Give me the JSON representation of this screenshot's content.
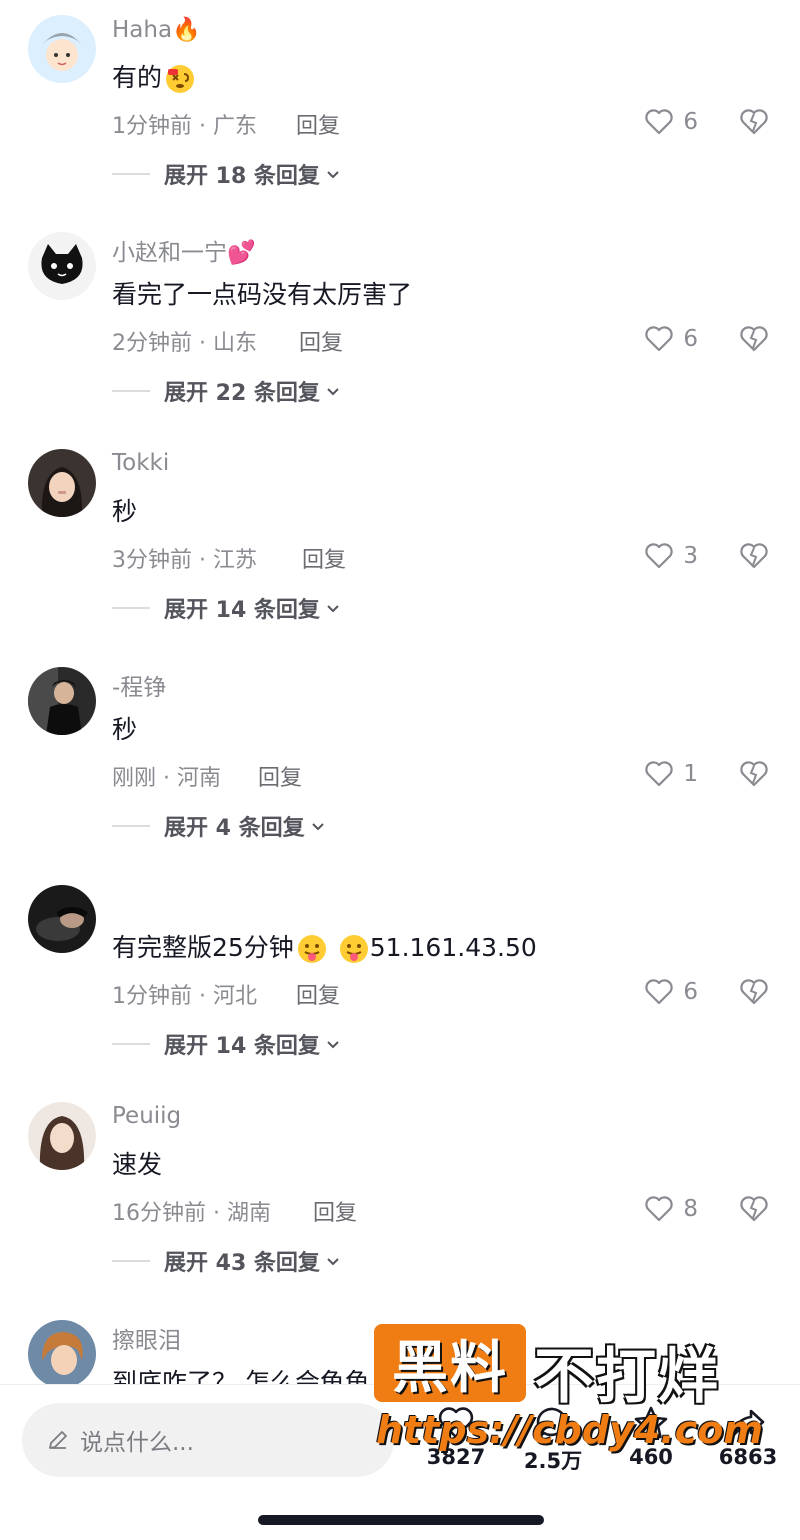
{
  "colors": {
    "accent": "#f07d14",
    "text": "#161823",
    "muted": "#8a8b91"
  },
  "comments": [
    {
      "user": "Haha",
      "user_emoji": "🔥",
      "text": "有的",
      "text_emoji": "dizzy-face",
      "time": "1分钟前 · 广东",
      "reply": "回复",
      "likes": "6",
      "expand": "展开 18 条回复"
    },
    {
      "user": "小赵和一宁",
      "user_emoji": "💕",
      "text": "看完了一点码没有太厉害了",
      "time": "2分钟前 · 山东",
      "reply": "回复",
      "likes": "6",
      "expand": "展开 22 条回复"
    },
    {
      "user": "Tokki",
      "text": "秒",
      "time": "3分钟前 · 江苏",
      "reply": "回复",
      "likes": "3",
      "expand": "展开 14 条回复"
    },
    {
      "user": "-程铮",
      "text": "秒",
      "time": "刚刚 · 河南",
      "reply": "回复",
      "likes": "1",
      "expand": "展开 4 条回复"
    },
    {
      "user": "",
      "text": "有完整版25分钟",
      "text_suffix": "51.161.43.50",
      "time": "1分钟前 · 河北",
      "reply": "回复",
      "likes": "6",
      "expand": "展开 14 条回复"
    },
    {
      "user": "Peuiig",
      "text": "速发",
      "time": "16分钟前 · 湖南",
      "reply": "回复",
      "likes": "8",
      "expand": "展开 43 条回复"
    },
    {
      "user": "擦眼泪",
      "text": "到底咋了？ 怎么会龟龟"
    }
  ],
  "bottom_bar": {
    "placeholder": "说点什么...",
    "likes_count": "3827",
    "comments_count": "2.5万",
    "favorites_count": "460",
    "shares_count": "6863"
  },
  "watermark": {
    "box_text": "黑料",
    "right_text": "不打烊",
    "url": "https://cbdy4.com"
  }
}
